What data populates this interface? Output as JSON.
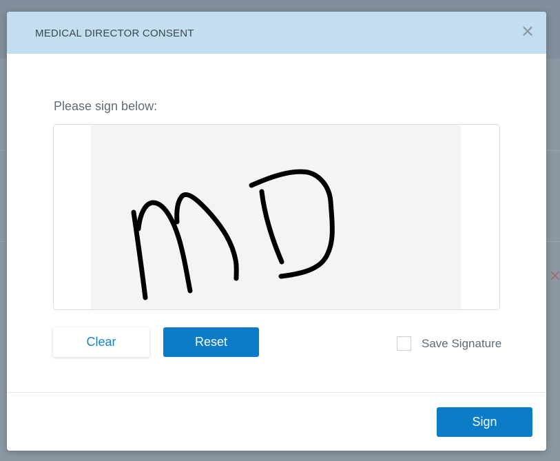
{
  "modal": {
    "title": "MEDICAL DIRECTOR CONSENT",
    "close_icon": "close-icon",
    "prompt": "Please sign below:",
    "signature_text": "MD",
    "clear_label": "Clear",
    "reset_label": "Reset",
    "save_signature_label": "Save Signature",
    "save_signature_checked": false,
    "sign_label": "Sign"
  },
  "colors": {
    "header_bg": "#c3def0",
    "primary": "#0b7cc5",
    "link": "#1b82c6",
    "overlay": "#808f9b"
  }
}
